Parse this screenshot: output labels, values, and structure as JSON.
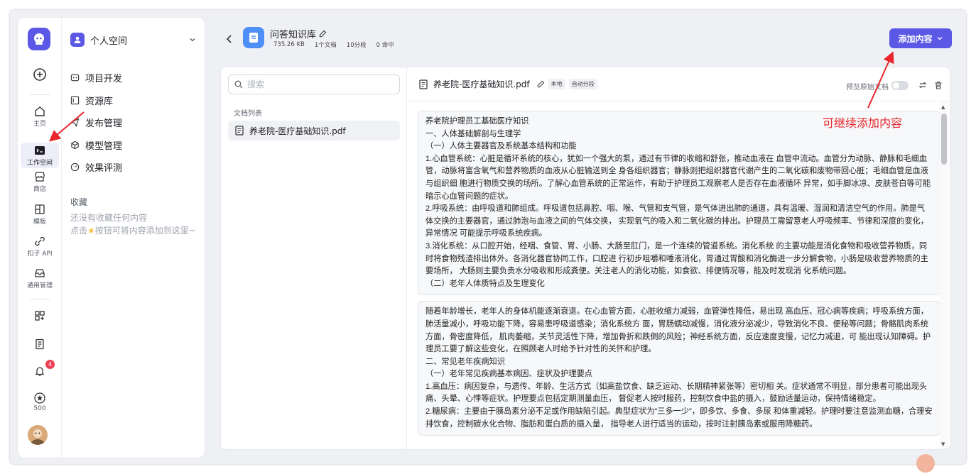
{
  "rail": {
    "items": [
      {
        "label": "主页"
      },
      {
        "label": "工作空间"
      },
      {
        "label": "商店"
      },
      {
        "label": "模板"
      },
      {
        "label": "扣子 API"
      },
      {
        "label": "通用管理"
      }
    ],
    "notification_count": "4",
    "points": "500"
  },
  "nav": {
    "space_name": "个人空间",
    "items": [
      {
        "label": "项目开发"
      },
      {
        "label": "资源库"
      },
      {
        "label": "发布管理"
      },
      {
        "label": "模型管理"
      },
      {
        "label": "效果评测"
      }
    ],
    "favorites_title": "收藏",
    "favorites_empty_line1": "还没有收藏任何内容",
    "favorites_empty_line2_pre": "点击",
    "favorites_empty_line2_post": "按钮可将内容添加到这里~"
  },
  "header": {
    "title": "问答知识库",
    "tags": [
      "735.26 KB",
      "1个文档",
      "10分段",
      "0 命中"
    ],
    "add_button": "添加内容"
  },
  "search": {
    "placeholder": "搜索"
  },
  "doc_list": {
    "title": "文档列表",
    "items": [
      {
        "name": "养老院-医疗基础知识.pdf"
      }
    ]
  },
  "document": {
    "name": "养老院-医疗基础知识.pdf",
    "tags": [
      "本地",
      "自动分段"
    ],
    "preview_label": "预览原始文档"
  },
  "chunks": [
    {
      "lines": [
        "养老院护理员工基础医疗知识",
        "一、人体基础解剖与生理学",
        "（一）人体主要器官及系统基本结构和功能",
        "1.心血管系统：心脏是循环系统的核心，犹如一个强大的泵，通过有节律的收缩和舒张，推动血液在 血管中流动。血管分为动脉、静脉和毛细血管，动脉将富含氧气和营养物质的血液从心脏输送到全 身各组织器官；静脉则把组织器官代谢产生的二氧化碳和废物带回心脏；毛细血管是血液与组织细 胞进行物质交换的场所。了解心血管系统的正常运作，有助于护理员工观察老人是否存在血液循环 异常，如手脚冰凉、皮肤苍白等可能暗示心血管问题的症状。",
        "2.呼吸系统：由呼吸道和肺组成。呼吸道包括鼻腔、咽、喉、气管和支气管，是气体进出肺的通道，具有温暖、湿润和清洁空气的作用。肺是气体交换的主要器官，通过肺泡与血液之间的气体交换， 实现氧气的吸入和二氧化碳的排出。护理员工需留意老人呼吸频率、节律和深度的变化，异常情况 可能提示呼吸系统疾病。",
        "3.消化系统：从口腔开始，经咽、食管、胃、小肠、大肠至肛门，是一个连续的管道系统。消化系统 的主要功能是消化食物和吸收营养物质，同时将食物残渣排出体外。各消化器官协同工作，口腔进 行初步咀嚼和唾液消化，胃通过胃酸和消化酶进一步分解食物，小肠是吸收营养物质的主要场所， 大肠则主要负责水分吸收和形成粪便。关注老人的消化功能，如食欲、排便情况等，能及时发现消 化系统问题。",
        "（二）老年人体质特点及生理变化"
      ]
    },
    {
      "lines": [
        "随着年龄增长，老年人的身体机能逐渐衰退。在心血管方面，心脏收缩力减弱，血管弹性降低，易出现 高血压、冠心病等疾病；呼吸系统方面，肺活量减小，呼吸功能下降，容易患呼吸道感染；消化系统方 面，胃肠蠕动减慢，消化液分泌减少，导致消化不良、便秘等问题；骨骼肌肉系统方面，骨密度降低， 肌肉萎缩，关节灵活性下降，增加骨折和跌倒的风险；神经系统方面，反应速度变慢，记忆力减退，可 能出现认知障碍。护理员工要了解这些变化，在照顾老人时给予针对性的关怀和护理。",
        "二、常见老年疾病知识",
        "（一）老年常见疾病基本病因、症状及护理要点",
        "1.高血压：病因复杂，与遗传、年龄、生活方式（如高盐饮食、缺乏运动、长期精神紧张等）密切相 关。症状通常不明显，部分患者可能出现头痛、头晕、心悸等症状。护理要点包括定期测量血压， 督促老人按时服药，控制饮食中盐的摄入，鼓励适量运动，保持情绪稳定。",
        "2.糖尿病：主要由于胰岛素分泌不足或作用缺陷引起。典型症状为“三多一少”，即多饮、多食、多尿 和体重减轻。护理时要注意监测血糖，合理安排饮食，控制碳水化合物、脂肪和蛋白质的摄入量， 指导老人进行适当的运动，按时注射胰岛素或服用降糖药。"
      ]
    }
  ],
  "annotation": "可继续添加内容",
  "colors": {
    "accent": "#5b58e6",
    "annotation": "#e8262c",
    "kb_icon": "#4d8ef7"
  }
}
